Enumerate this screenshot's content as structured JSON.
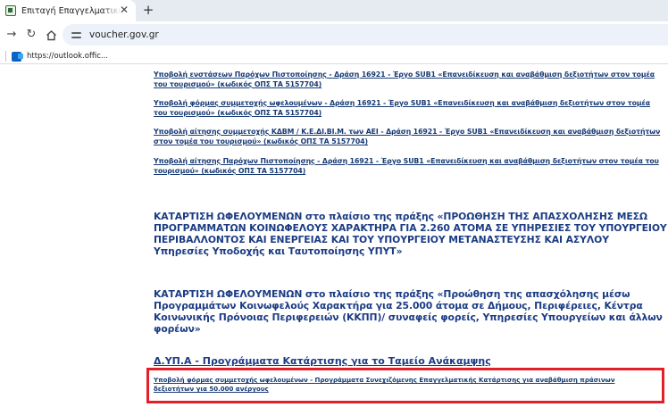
{
  "browser": {
    "tab_title": "Επιταγή Επαγγελματικής Κατάρ",
    "tab_close": "✕",
    "new_tab": "+",
    "url": "voucher.gov.gr",
    "bookmark_label": "https://outlook.offic..."
  },
  "content": {
    "links": [
      "Υποβολή ενστάσεων Παρόχων Πιστοποίησης - Δράση 16921 - Έργο SUB1 «Επανειδίκευση και αναβάθμιση δεξιοτήτων στον τομέα του τουρισμού» (κωδικός ΟΠΣ ΤΑ 5157704)",
      "Υποβολή φόρμας συμμετοχής ωφελουμένων - Δράση 16921 - Έργο SUB1 «Επανειδίκευση και αναβάθμιση δεξιοτήτων στον τομέα του τουρισμού» (κωδικός ΟΠΣ ΤΑ 5157704)",
      "Υποβολή αίτησης συμμετοχής ΚΔΒΜ / Κ.Ε.ΔΙ.ΒΙ.Μ. των ΑΕΙ - Δράση 16921 - Έργο SUB1 «Επανειδίκευση και αναβάθμιση δεξιοτήτων στον τομέα του τουρισμού» (κωδικός ΟΠΣ ΤΑ 5157704)",
      "Υποβολή αίτησης Παρόχων Πιστοποίησης - Δράση 16921 - Έργο SUB1 «Επανειδίκευση και αναβάθμιση δεξιοτήτων στον τομέα του τουρισμού» (κωδικός ΟΠΣ ΤΑ 5157704)"
    ],
    "heading_1": "ΚΑΤΑΡΤΙΣΗ ΩΦΕΛΟΥΜΕΝΩΝ στο πλαίσιο της πράξης «ΠΡΟΩΘΗΣΗ ΤΗΣ ΑΠΑΣΧΟΛΗΣΗΣ ΜΕΣΩ ΠΡΟΓΡΑΜΜΑΤΩΝ ΚΟΙΝΩΦΕΛΟΥΣ ΧΑΡΑΚΤΗΡΑ ΓΙΑ 2.260 ΑΤΟΜΑ ΣΕ ΥΠΗΡΕΣΙΕΣ ΤΟΥ ΥΠΟΥΡΓΕΙΟΥ ΠΕΡΙΒΑΛΛΟΝΤΟΣ ΚΑΙ ΕΝΕΡΓΕΙΑΣ ΚΑΙ ΤΟΥ ΥΠΟΥΡΓΕΙΟΥ ΜΕΤΑΝΑΣΤΕΥΣΗΣ ΚΑΙ ΑΣΥΛΟΥ Υπηρεσίες Υποδοχής και Ταυτοποίησης ΥΠΥΤ»",
    "heading_2": "ΚΑΤΑΡΤΙΣΗ ΩΦΕΛΟΥΜΕΝΩΝ στο πλαίσιο της πράξης «Προώθηση της απασχόλησης μέσω Προγραμμάτων Κοινωφελούς Χαρακτήρα για 25.000 άτομα σε Δήμους, Περιφέρειες, Κέντρα Κοινωνικής Πρόνοιας Περιφερειών (ΚΚΠΠ)/ συναφείς φορείς, Υπηρεσίες Υπουργείων και άλλων φορέων»",
    "heading_3": "Δ.ΥΠ.Α - Προγράμματα Κατάρτισης για το Ταμείο Ανάκαμψης",
    "highlighted_link": "Υποβολή φόρμας συμμετοχής ωφελουμένων - Προγράμματα Συνεχιζόμενης Επαγγελματικής Κατάρτισης για αναβάθμιση πράσινων δεξιοτήτων για 50.000 ανέργους",
    "highlight_color": "#e3202a",
    "link_color": "#173a74"
  }
}
